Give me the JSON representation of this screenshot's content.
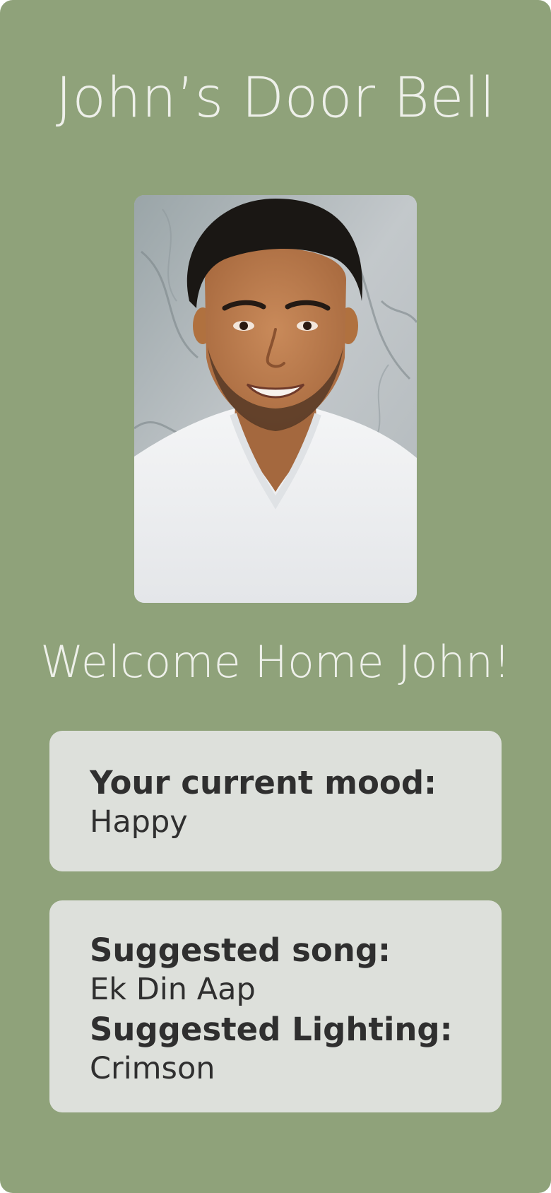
{
  "header": {
    "title": "John’s Door Bell"
  },
  "visitor_photo": {
    "alt": "Visitor camera snapshot"
  },
  "greeting": "Welcome Home John!",
  "mood_card": {
    "label": "Your current mood:",
    "value": "Happy"
  },
  "suggestion_card": {
    "song_label": "Suggested song:",
    "song_value": "Ek Din Aap",
    "lighting_label": "Suggested Lighting:",
    "lighting_value": "Crimson"
  },
  "colors": {
    "background": "#8fa27a",
    "card": "#dde0db",
    "heading_text": "#eef0ea",
    "body_text": "#2f2f2f"
  }
}
